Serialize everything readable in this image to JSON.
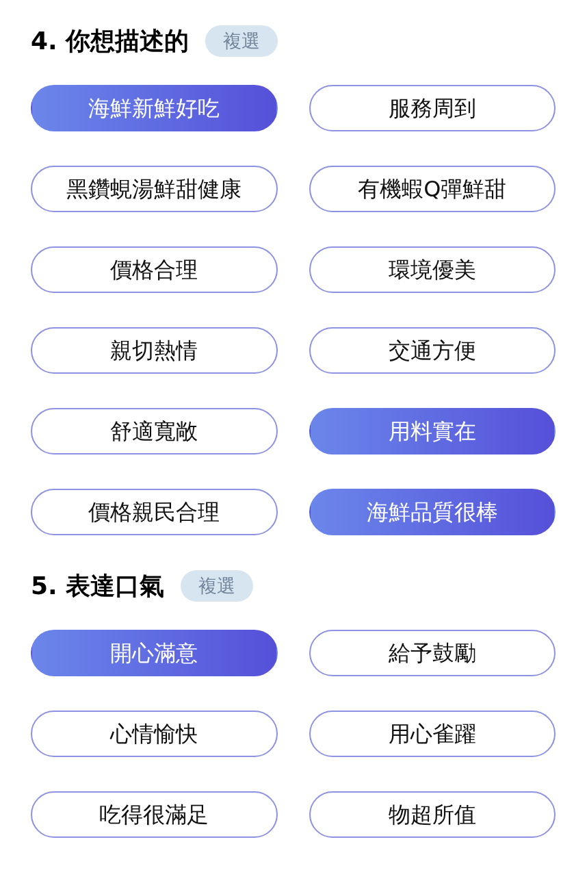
{
  "sections": [
    {
      "title": "4. 你想描述的",
      "badge": "複選",
      "options": [
        {
          "label": "海鮮新鮮好吃",
          "selected": true
        },
        {
          "label": "服務周到",
          "selected": false
        },
        {
          "label": "黑鑽蜆湯鮮甜健康",
          "selected": false
        },
        {
          "label": "有機蝦Q彈鮮甜",
          "selected": false
        },
        {
          "label": "價格合理",
          "selected": false
        },
        {
          "label": "環境優美",
          "selected": false
        },
        {
          "label": "親切熱情",
          "selected": false
        },
        {
          "label": "交通方便",
          "selected": false
        },
        {
          "label": "舒適寬敞",
          "selected": false
        },
        {
          "label": "用料實在",
          "selected": true
        },
        {
          "label": "價格親民合理",
          "selected": false
        },
        {
          "label": "海鮮品質很棒",
          "selected": true
        }
      ]
    },
    {
      "title": "5. 表達口氣",
      "badge": "複選",
      "options": [
        {
          "label": "開心滿意",
          "selected": true
        },
        {
          "label": "給予鼓勵",
          "selected": false
        },
        {
          "label": "心情愉快",
          "selected": false
        },
        {
          "label": "用心雀躍",
          "selected": false
        },
        {
          "label": "吃得很滿足",
          "selected": false
        },
        {
          "label": "物超所值",
          "selected": false
        }
      ]
    }
  ]
}
